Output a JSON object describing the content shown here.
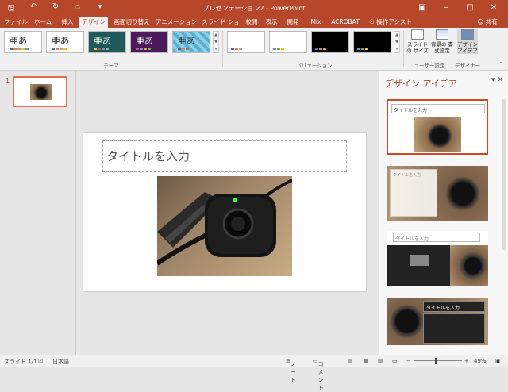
{
  "window": {
    "title": "プレゼンテーション2 - PowerPoint"
  },
  "tabs": [
    {
      "label": "ファイル",
      "active": false
    },
    {
      "label": "ホーム",
      "active": false
    },
    {
      "label": "挿入",
      "active": false
    },
    {
      "label": "デザイン",
      "active": true
    },
    {
      "label": "画面切り替え",
      "active": false
    },
    {
      "label": "アニメーション",
      "active": false
    },
    {
      "label": "スライド ショー",
      "active": false
    },
    {
      "label": "校閲",
      "active": false
    },
    {
      "label": "表示",
      "active": false
    },
    {
      "label": "開発",
      "active": false
    },
    {
      "label": "Mix",
      "active": false
    },
    {
      "label": "ACROBAT",
      "active": false
    },
    {
      "label": "操作アシスト",
      "active": false
    }
  ],
  "user": {
    "share_label": "共有"
  },
  "ribbon": {
    "themes_group_label": "テーマ",
    "variations_group_label": "バリエーション",
    "user_settings_group_label": "ユーザー設定",
    "designer_group_label": "デザイナー",
    "theme_sample_text": "亜あ",
    "slide_size_label": "スライドの サイズ",
    "format_background_label": "背景の 書式設定",
    "design_ideas_label": "デザイン アイデア"
  },
  "thumbnails": [
    {
      "number": "1"
    }
  ],
  "slide": {
    "title_placeholder": "タイトルを入力"
  },
  "design_pane": {
    "title": "デザイン アイデア",
    "idea_title_text": "タイトルを入力"
  },
  "status": {
    "slide_info": "スライド 1/1",
    "language": "日本語",
    "notes_label": "ノート",
    "comments_label": "コメント",
    "zoom": "49%"
  },
  "colors": {
    "accent": "#b7472a",
    "selection": "#d24726"
  }
}
